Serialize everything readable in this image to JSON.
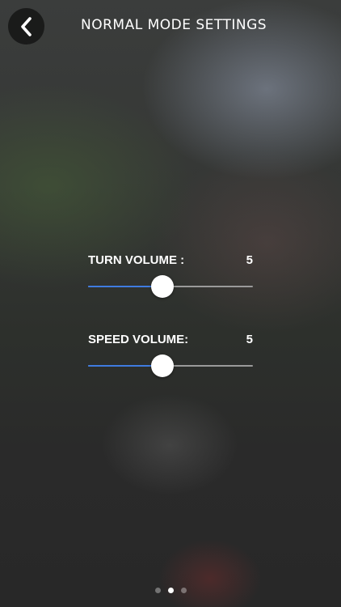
{
  "header": {
    "title": "NORMAL MODE SETTINGS",
    "back_icon": "chevron-left-icon"
  },
  "settings": [
    {
      "id": "turn-volume",
      "label": "TURN VOLUME :",
      "value": "5",
      "level": 5,
      "max": 10
    },
    {
      "id": "speed-volume",
      "label": "SPEED VOLUME:",
      "value": "5",
      "level": 5,
      "max": 10
    }
  ],
  "page_indicator": {
    "count": 3,
    "active_index": 1
  },
  "colors": {
    "slider_fill": "#3f7be0",
    "slider_track": "#9a9a9a",
    "thumb": "#ffffff"
  }
}
